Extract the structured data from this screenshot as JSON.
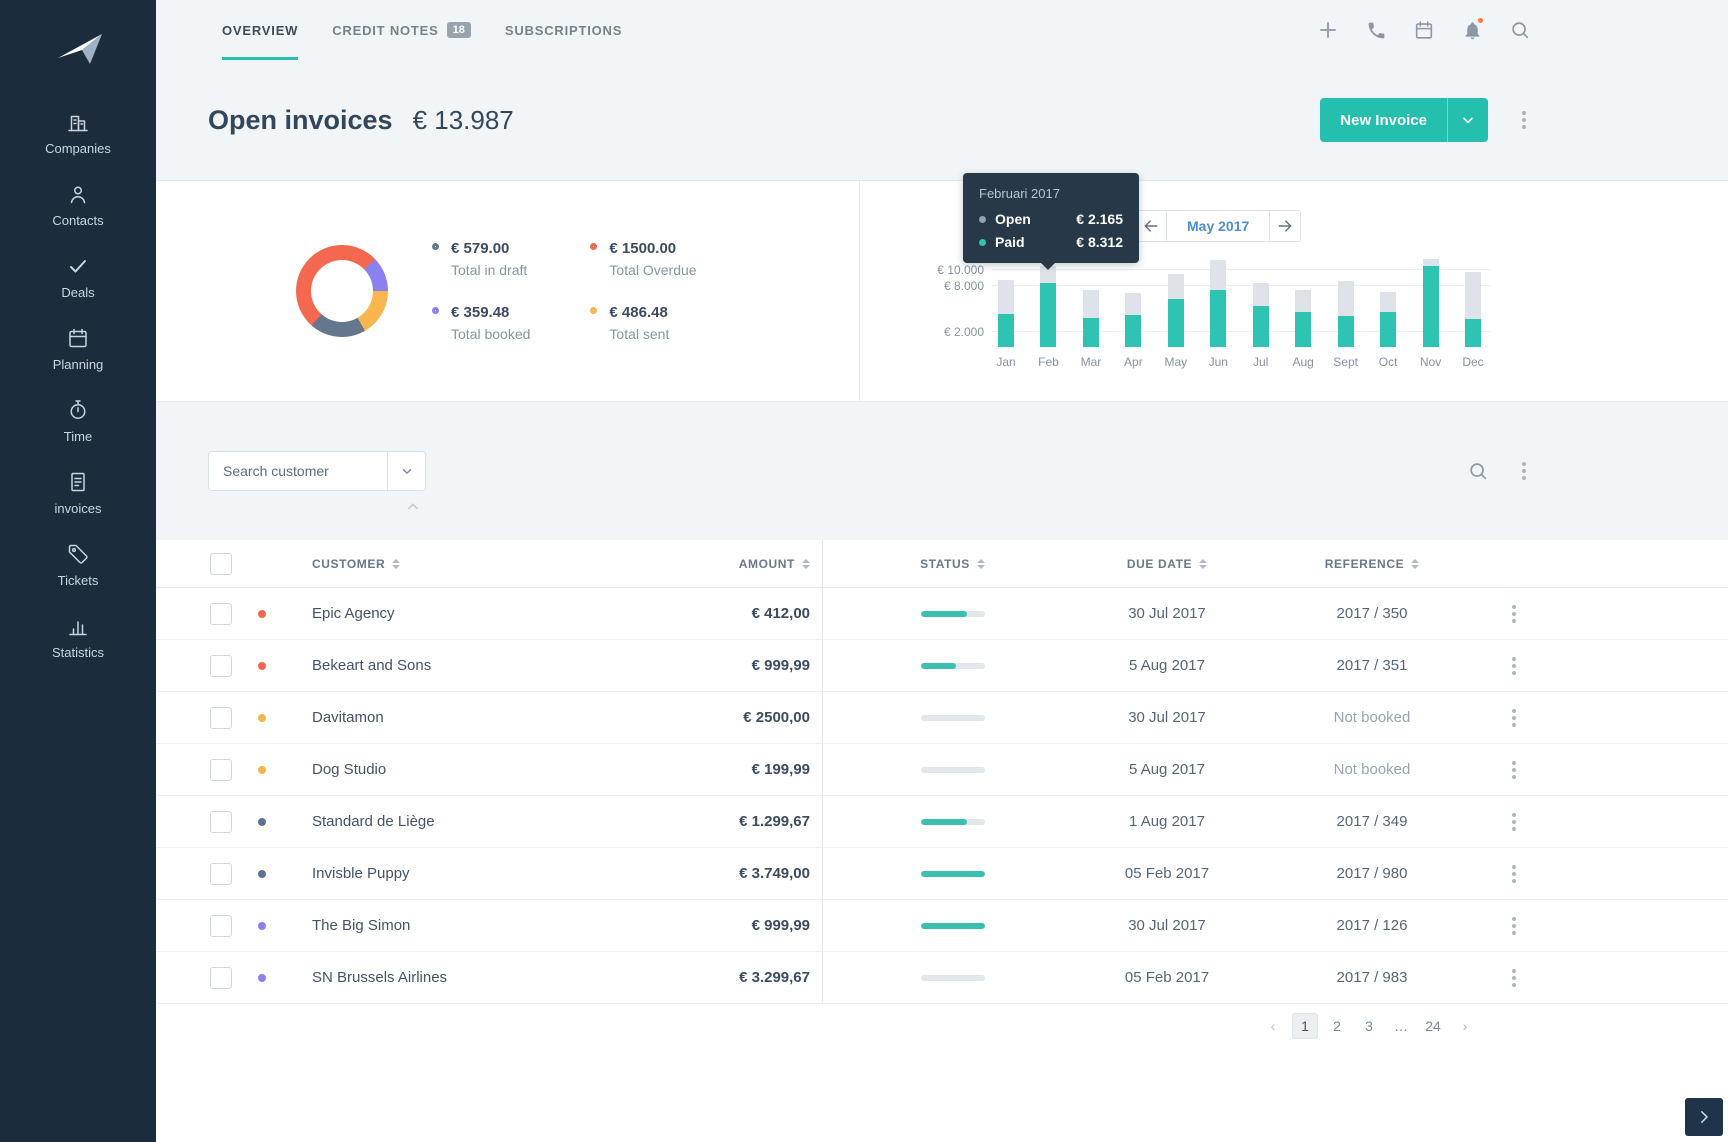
{
  "colors": {
    "accent": "#25bfae",
    "sidebar_bg": "#1b2c3d",
    "paid": "#2fc4b2",
    "open": "#dde3e9",
    "progress": "#3ac0b0",
    "notification_dot": "#ff7b3c"
  },
  "sidebar": {
    "items": [
      {
        "label": "Companies"
      },
      {
        "label": "Contacts"
      },
      {
        "label": "Deals"
      },
      {
        "label": "Planning"
      },
      {
        "label": "Time"
      },
      {
        "label": "invoices"
      },
      {
        "label": "Tickets"
      },
      {
        "label": "Statistics"
      }
    ]
  },
  "topbar": {
    "tabs": [
      {
        "label": "OVERVIEW"
      },
      {
        "label": "CREDIT NOTES",
        "badge": "18"
      },
      {
        "label": "SUBSCRIPTIONS"
      }
    ]
  },
  "header": {
    "title": "Open invoices",
    "total": "€ 13.987",
    "new_invoice": "New Invoice"
  },
  "summary": {
    "items": [
      {
        "amount": "€ 579.00",
        "label": "Total in draft",
        "color": "#64778d"
      },
      {
        "amount": "€ 1500.00",
        "label": "Total Overdue",
        "color": "#f4684f"
      },
      {
        "amount": "€ 359.48",
        "label": "Total booked",
        "color": "#8b80f0"
      },
      {
        "amount": "€ 486.48",
        "label": "Total sent",
        "color": "#f9b64e"
      }
    ]
  },
  "chart_data": [
    {
      "type": "pie",
      "title": "Open invoices breakdown",
      "labels": [
        "Total in draft",
        "Total Overdue",
        "Total booked",
        "Total sent"
      ],
      "values": [
        579.0,
        1500.0,
        359.48,
        486.48
      ],
      "colors": [
        "#64778d",
        "#f4684f",
        "#8b80f0",
        "#f9b64e"
      ]
    },
    {
      "type": "bar",
      "stacked": true,
      "categories": [
        "Jan",
        "Feb",
        "Mar",
        "Apr",
        "May",
        "Jun",
        "Jul",
        "Aug",
        "Sept",
        "Oct",
        "Nov",
        "Dec"
      ],
      "series": [
        {
          "name": "Paid",
          "color": "#2fc4b2",
          "values": [
            4300,
            8312,
            3800,
            4200,
            6200,
            7400,
            5400,
            4600,
            4100,
            4500,
            10500,
            3600
          ]
        },
        {
          "name": "Open",
          "color": "#dde3e9",
          "values": [
            4400,
            2165,
            3700,
            2900,
            3200,
            3900,
            3000,
            2900,
            4600,
            2600,
            900,
            6100
          ]
        }
      ],
      "ylim": [
        0,
        12500
      ],
      "yticks": [
        {
          "value": 2000,
          "label": "€ 2.000"
        },
        {
          "value": 8000,
          "label": "€ 8.000"
        },
        {
          "value": 10000,
          "label": "€ 10.000"
        }
      ],
      "legend_position": "none",
      "grid": true
    }
  ],
  "chart_tooltip": {
    "title": "Februari 2017",
    "rows": [
      {
        "label": "Open",
        "value": "€ 2.165",
        "color": "#93a2b1"
      },
      {
        "label": "Paid",
        "value": "€ 8.312",
        "color": "#2fc4b2"
      }
    ]
  },
  "month_nav": {
    "current": "May 2017"
  },
  "search": {
    "placeholder": "Search customer"
  },
  "table": {
    "columns": [
      "CUSTOMER",
      "AMOUNT",
      "STATUS",
      "DUE DATE",
      "REFERENCE"
    ],
    "rows": [
      {
        "customer": "Epic Agency",
        "amount": "€ 412,00",
        "progress": 72,
        "due_date": "30 Jul 2017",
        "reference": "2017 / 350",
        "dot_color": "#f4684f",
        "muted_ref": false
      },
      {
        "customer": "Bekeart and Sons",
        "amount": "€ 999,99",
        "progress": 55,
        "due_date": "5 Aug 2017",
        "reference": "2017 / 351",
        "dot_color": "#f4684f",
        "muted_ref": false
      },
      {
        "customer": "Davitamon",
        "amount": "€ 2500,00",
        "progress": 0,
        "due_date": "30 Jul 2017",
        "reference": "Not booked",
        "dot_color": "#f9b64e",
        "muted_ref": true
      },
      {
        "customer": "Dog Studio",
        "amount": "€ 199,99",
        "progress": 0,
        "due_date": "5 Aug 2017",
        "reference": "Not booked",
        "dot_color": "#f9b64e",
        "muted_ref": true
      },
      {
        "customer": "Standard de Liège",
        "amount": "€ 1.299,67",
        "progress": 72,
        "due_date": "1 Aug 2017",
        "reference": "2017 / 349",
        "dot_color": "#5d7392",
        "muted_ref": false
      },
      {
        "customer": "Invisble Puppy",
        "amount": "€ 3.749,00",
        "progress": 100,
        "due_date": "05 Feb 2017",
        "reference": "2017 / 980",
        "dot_color": "#5d7392",
        "muted_ref": false
      },
      {
        "customer": "The Big Simon",
        "amount": "€ 999,99",
        "progress": 100,
        "due_date": "30 Jul 2017",
        "reference": "2017 / 126",
        "dot_color": "#8b80f0",
        "muted_ref": false
      },
      {
        "customer": "SN Brussels Airlines",
        "amount": "€ 3.299,67",
        "progress": 0,
        "due_date": "05 Feb 2017",
        "reference": "2017 / 983",
        "dot_color": "#8b80f0",
        "muted_ref": false
      }
    ]
  },
  "pagination": {
    "prev": "‹",
    "pages": [
      "1",
      "2",
      "3"
    ],
    "ellipsis": "…",
    "last": "24",
    "next": "›"
  }
}
